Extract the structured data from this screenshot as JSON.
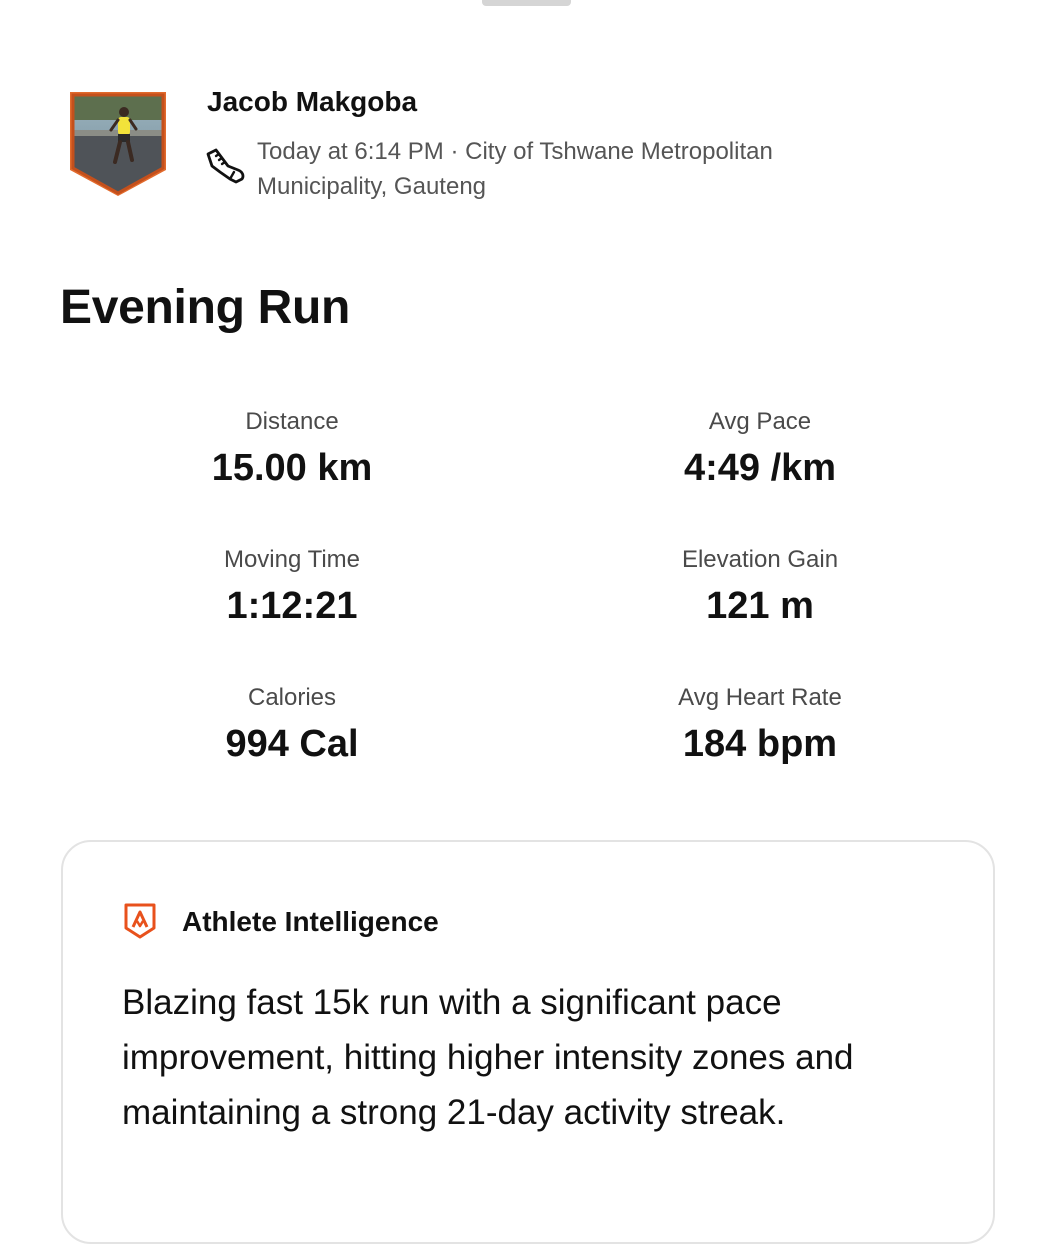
{
  "athlete": {
    "name": "Jacob Makgoba",
    "activity_type_icon": "running-shoe-icon",
    "timestamp": "Today at 6:14 PM",
    "separator": " · ",
    "location": "City of Tshwane Metropolitan Municipality, Gauteng"
  },
  "activity": {
    "title": "Evening Run"
  },
  "stats": {
    "distance": {
      "label": "Distance",
      "value": "15.00 km"
    },
    "avg_pace": {
      "label": "Avg Pace",
      "value": "4:49 /km"
    },
    "moving_time": {
      "label": "Moving Time",
      "value": "1:12:21"
    },
    "elevation_gain": {
      "label": "Elevation Gain",
      "value": "121 m"
    },
    "calories": {
      "label": "Calories",
      "value": "994 Cal"
    },
    "avg_heart_rate": {
      "label": "Avg Heart Rate",
      "value": "184 bpm"
    }
  },
  "athlete_intelligence": {
    "icon": "strava-shield-icon",
    "title": "Athlete Intelligence",
    "summary": "Blazing fast 15k run with a significant pace improvement, hitting higher intensity zones and maintaining a strong 21-day activity streak."
  },
  "colors": {
    "brand_orange": "#e8511c",
    "text_primary": "#111111",
    "text_secondary": "#555555",
    "card_border": "#e3e3e3"
  }
}
